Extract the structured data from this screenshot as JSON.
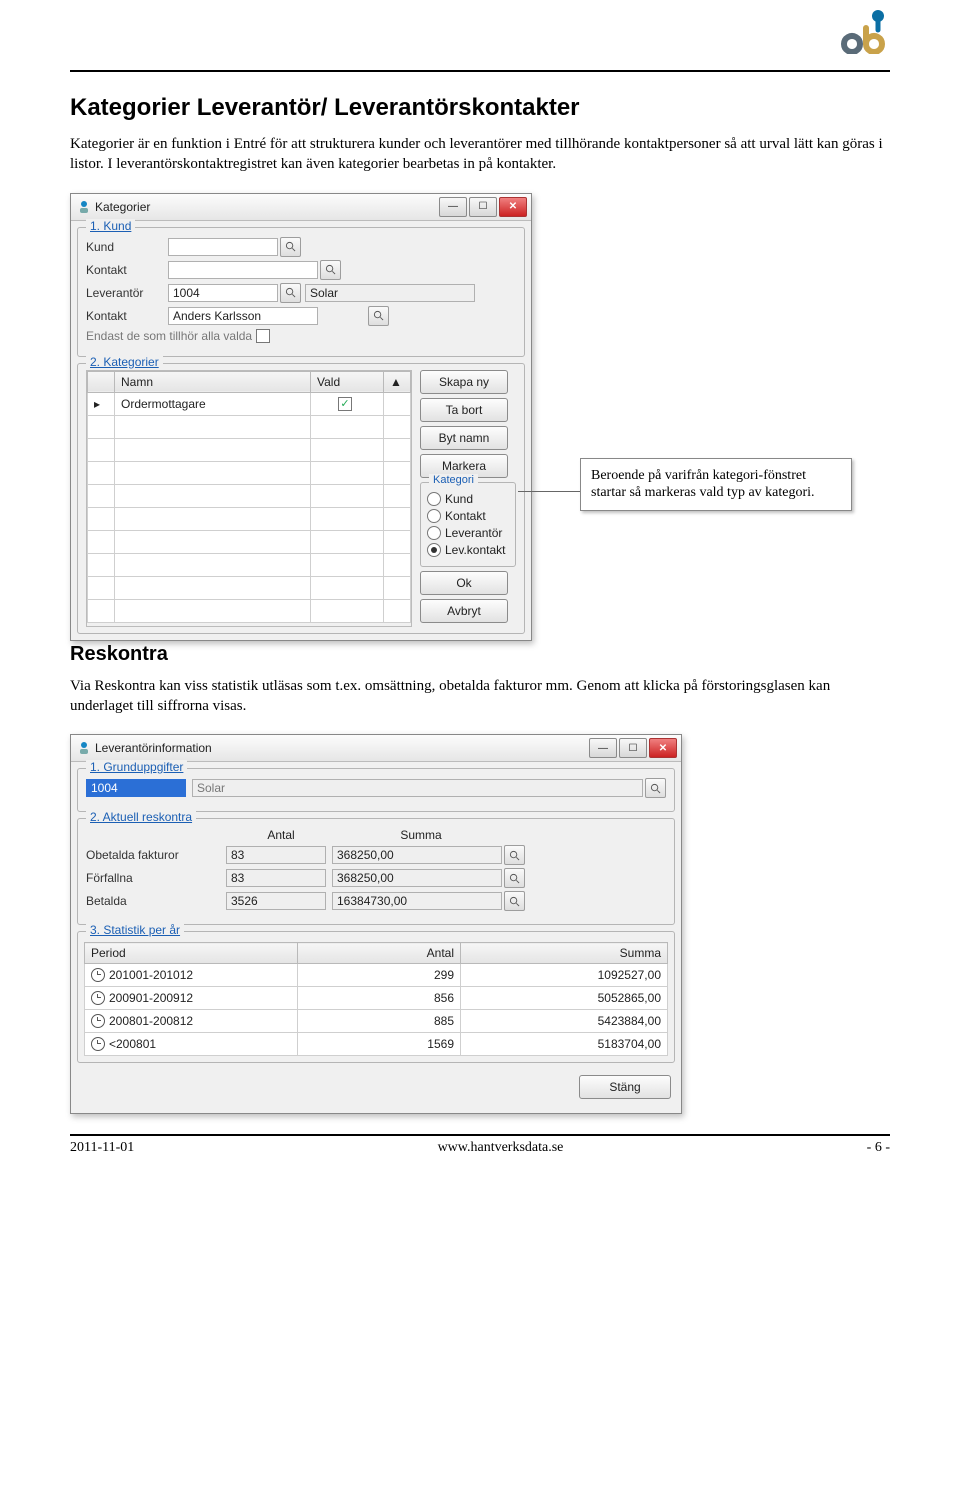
{
  "heading1": "Kategorier Leverantör/ Leverantörskontakter",
  "para1": "Kategorier är en funktion i Entré för att strukturera kunder och leverantörer med tillhörande kontaktpersoner så att urval lätt kan göras i listor. I leverantörskontaktregistret kan även kategorier bearbetas in på kontakter.",
  "callout1": "Beroende på varifrån kategori-fönstret startar så markeras vald typ av kategori.",
  "heading2": "Reskontra",
  "para2": "Via Reskontra kan viss statistik utläsas som t.ex. omsättning, obetalda fakturor mm. Genom att klicka på förstoringsglasen kan underlaget till siffrorna visas.",
  "win1": {
    "title": "Kategorier",
    "group1": "1. Kund",
    "labels": {
      "kund": "Kund",
      "kontakt": "Kontakt",
      "lev": "Leverantör"
    },
    "lev_value": "1004",
    "lev_name": "Solar",
    "kontakt_value": "Anders Karlsson",
    "endast": "Endast de som tillhör alla valda",
    "group2": "2. Kategorier",
    "tbl_headers": {
      "namn": "Namn",
      "vald": "Vald"
    },
    "row1": "Ordermottagare",
    "btn_ny": "Skapa ny",
    "btn_tabort": "Ta bort",
    "btn_byt": "Byt namn",
    "btn_markera": "Markera",
    "grp_kategori": "Kategori",
    "r_kund": "Kund",
    "r_kontakt": "Kontakt",
    "r_lev": "Leverantör",
    "r_levk": "Lev.kontakt",
    "btn_ok": "Ok",
    "btn_avbryt": "Avbryt"
  },
  "win2": {
    "title": "Leverantörinformation",
    "group1": "1. Grunduppgifter",
    "id": "1004",
    "name": "Solar",
    "group2": "2. Aktuell reskontra",
    "h_antal": "Antal",
    "h_summa": "Summa",
    "rows2": [
      {
        "lbl": "Obetalda fakturor",
        "antal": "83",
        "summa": "368250,00"
      },
      {
        "lbl": "Förfallna",
        "antal": "83",
        "summa": "368250,00"
      },
      {
        "lbl": "Betalda",
        "antal": "3526",
        "summa": "16384730,00"
      }
    ],
    "group3": "3. Statistik per år",
    "h_period": "Period",
    "rows3": [
      {
        "p": "201001-201012",
        "a": "299",
        "s": "1092527,00"
      },
      {
        "p": "200901-200912",
        "a": "856",
        "s": "5052865,00"
      },
      {
        "p": "200801-200812",
        "a": "885",
        "s": "5423884,00"
      },
      {
        "p": "<200801",
        "a": "1569",
        "s": "5183704,00"
      }
    ],
    "btn_stang": "Stäng"
  },
  "footer": {
    "date": "2011-11-01",
    "url": "www.hantverksdata.se",
    "page": "- 6 -"
  }
}
